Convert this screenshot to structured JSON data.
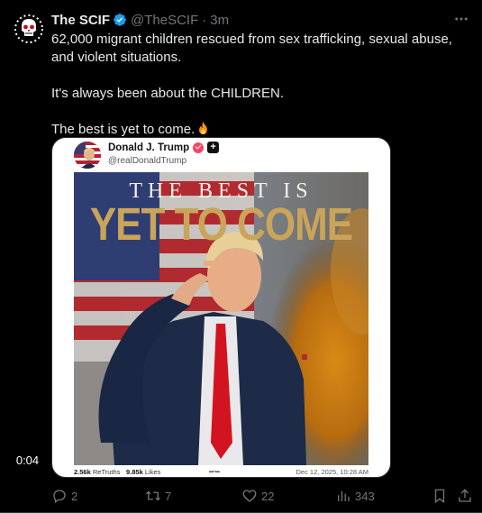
{
  "author": {
    "display_name": "The SCIF",
    "handle": "@TheSCIF",
    "separator": "·",
    "time": "3m"
  },
  "tweet_text": {
    "line1": "62,000 migrant children rescued from sex trafficking, sexual abuse, and violent situations.",
    "line2": "It's always been about the CHILDREN.",
    "line3": "The best is yet to come."
  },
  "embed": {
    "name": "Donald J. Trump",
    "handle": "@realDonaldTrump",
    "plus_glyph": "+",
    "headline_top": "THE BEST IS",
    "headline_bottom": "YET TO COME",
    "duration": "0:04",
    "retruths_count": "2.56k",
    "retruths_label": "ReTruths",
    "likes_count": "9.85k",
    "likes_label": "Likes",
    "date": "Dec 12, 2025, 10:28 AM"
  },
  "actions": {
    "replies": "2",
    "reposts": "7",
    "likes": "22",
    "views": "343"
  },
  "colors": {
    "background": "#000000",
    "text_primary": "#e7e9ea",
    "text_secondary": "#71767b",
    "verified_blue": "#1d9bf0"
  }
}
